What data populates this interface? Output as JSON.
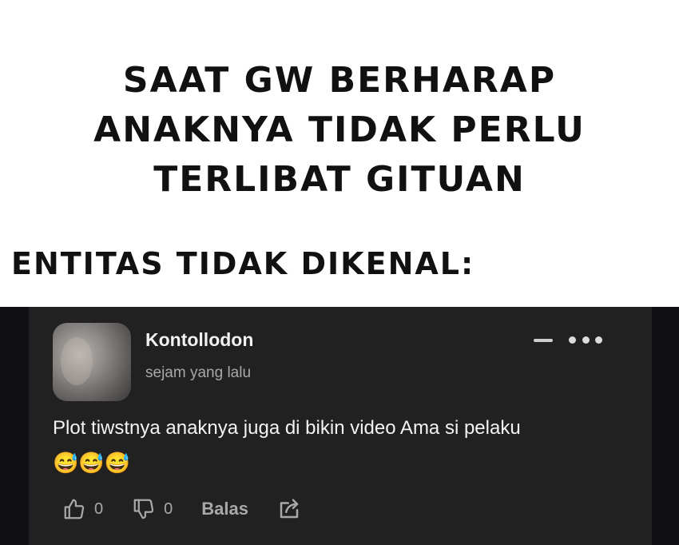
{
  "caption": {
    "headline_lines": [
      "SAAT GW BERHARAP",
      "ANAKNYA TIDAK PERLU",
      "TERLIBAT GITUAN"
    ],
    "subhead": "ENTITAS TIDAK DIKENAL:"
  },
  "comment": {
    "username": "Kontollodon",
    "timestamp": "sejam yang lalu",
    "text": "Plot tiwstnya anaknya juga di bikin video Ama si pelaku",
    "emojis": "😅😅😅",
    "like_count": "0",
    "dislike_count": "0",
    "reply_label": "Balas"
  },
  "icons": {
    "like": "thumbs-up-icon",
    "dislike": "thumbs-down-icon",
    "share": "share-icon",
    "more": "more-options-icon",
    "minimize": "minimize-icon"
  },
  "colors": {
    "card_bg": "#212121",
    "page_dark_bg": "#111115",
    "text_primary": "#f1f1f1",
    "text_secondary": "#a8a8a8"
  }
}
